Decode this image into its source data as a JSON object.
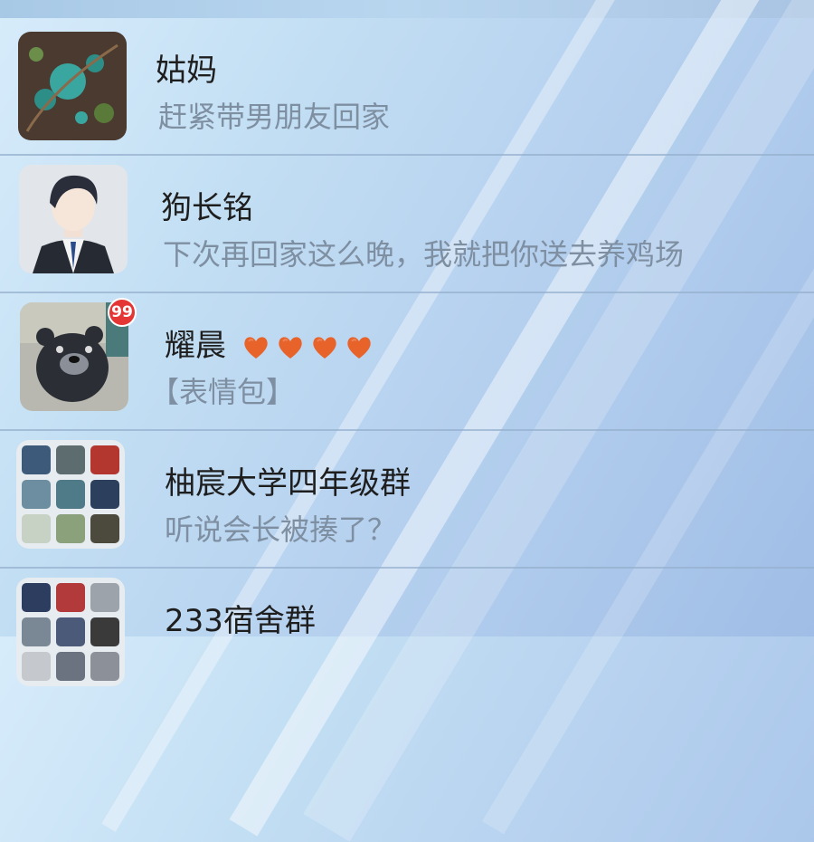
{
  "chats": [
    {
      "name": "姑妈",
      "preview": "赶紧带男朋友回家",
      "avatar": "floral-pattern-avatar"
    },
    {
      "name": "狗长铭",
      "preview": "下次再回家这么晚，我就把你送去养鸡场",
      "avatar": "man-in-suit-avatar"
    },
    {
      "name": "耀晨",
      "preview": "【表情包】",
      "badge": "99",
      "hearts": [
        "heart-icon",
        "heart-icon",
        "heart-icon",
        "heart-icon"
      ],
      "avatar": "bear-avatar"
    },
    {
      "name": "柚宸大学四年级群",
      "preview": "听说会长被揍了？",
      "avatar": "group-avatar"
    },
    {
      "name": "233宿舍群",
      "preview": "",
      "avatar": "group-avatar"
    }
  ],
  "colors": {
    "badge": "#e53636",
    "heart": "#e8632a",
    "name": "#1e1e1e",
    "preview": "#7f8fa2"
  }
}
